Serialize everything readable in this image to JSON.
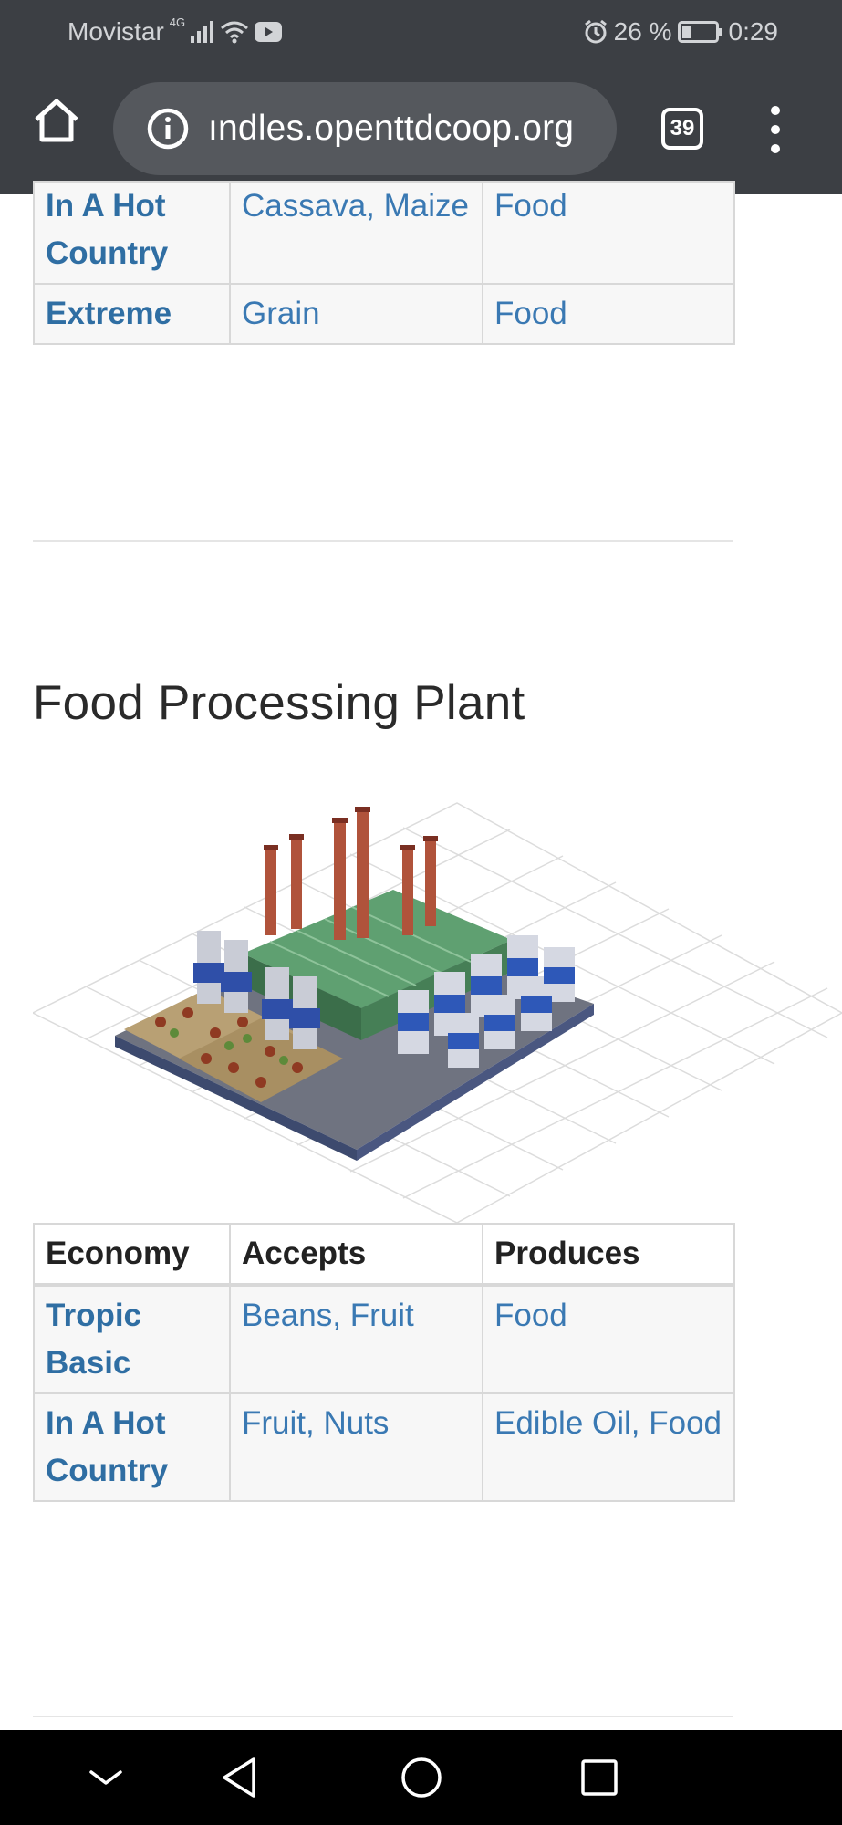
{
  "status_bar": {
    "carrier": "Movistar",
    "network": "4G",
    "battery": "26 %",
    "time": "0:29"
  },
  "browser": {
    "url": "ındles.openttdcoop.org",
    "tab_count": "39"
  },
  "top_table": {
    "rows": [
      {
        "economy": "In A Hot Country",
        "accepts": "Cassava, Maize",
        "produces": "Food"
      },
      {
        "economy": "Extreme",
        "accepts": "Grain",
        "produces": "Food"
      }
    ]
  },
  "section": {
    "title": "Food Processing Plant"
  },
  "industry_table": {
    "headers": {
      "economy": "Economy",
      "accepts": "Accepts",
      "produces": "Produces"
    },
    "rows": [
      {
        "economy": "Tropic Basic",
        "accepts": "Beans, Fruit",
        "produces": "Food"
      },
      {
        "economy": "In A Hot Country",
        "accepts": "Fruit, Nuts",
        "produces": "Edible Oil, Food"
      }
    ]
  },
  "icons": [
    "home-icon",
    "info-icon",
    "tabs-icon",
    "more-vert-icon",
    "back-icon",
    "home-circle-icon",
    "recents-icon",
    "collapse-icon",
    "alarm-icon",
    "battery-icon",
    "wifi-icon",
    "signal-icon",
    "youtube-icon"
  ]
}
